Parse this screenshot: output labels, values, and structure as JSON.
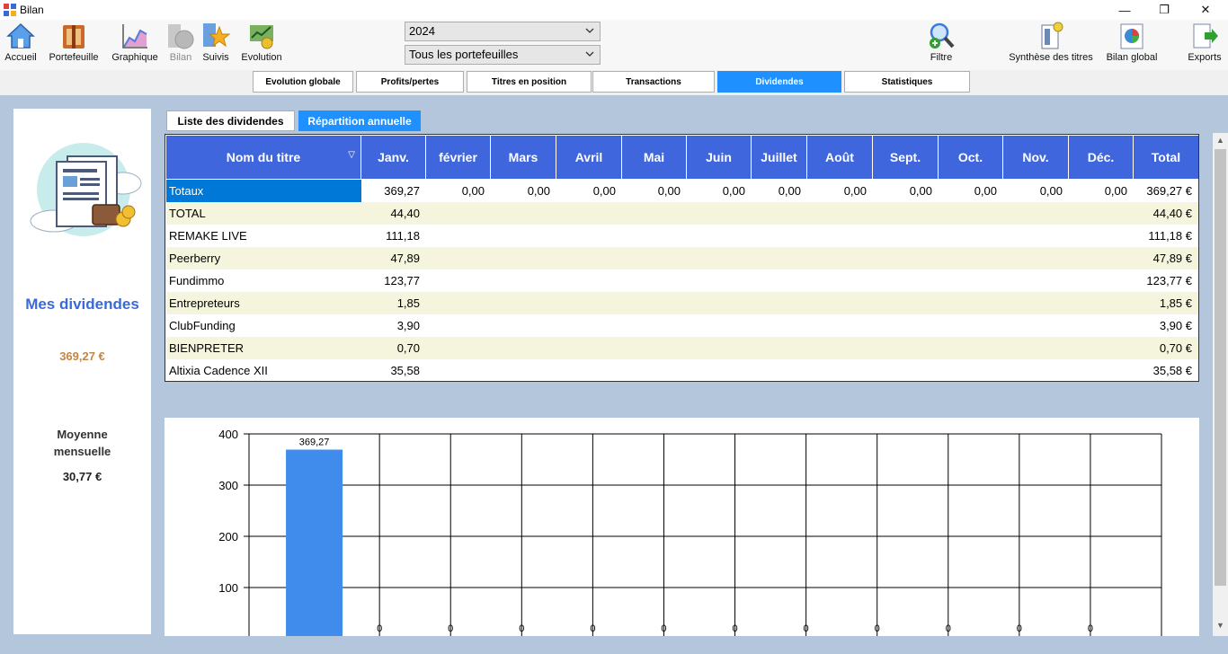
{
  "window": {
    "title": "Bilan",
    "minimize": "—",
    "maximize": "❐",
    "close": "✕"
  },
  "toolbar": {
    "items": [
      {
        "label": "Accueil",
        "icon": "home-icon"
      },
      {
        "label": "Portefeuille",
        "icon": "wallet-book-icon"
      },
      {
        "label": "Graphique",
        "icon": "chart-icon"
      },
      {
        "label": "Bilan",
        "icon": "coins-icon",
        "disabled": true
      },
      {
        "label": "Suivis",
        "icon": "star-bookmark-icon"
      },
      {
        "label": "Evolution",
        "icon": "money-growth-icon"
      },
      {
        "label": "Filtre",
        "icon": "magnifier-plus-icon"
      },
      {
        "label": "Synthèse des titres",
        "icon": "pin-document-icon"
      },
      {
        "label": "Bilan global",
        "icon": "pie-document-icon"
      },
      {
        "label": "Exports",
        "icon": "export-arrow-icon"
      }
    ],
    "year_select": "2024",
    "portfolio_select": "Tous les portefeuilles"
  },
  "main_tabs": [
    {
      "label": "Evolution globale"
    },
    {
      "label": "Profits/pertes"
    },
    {
      "label": "Titres en position"
    },
    {
      "label": "Transactions"
    },
    {
      "label": "Dividendes",
      "active": true
    },
    {
      "label": "Statistiques"
    }
  ],
  "sub_tabs": [
    {
      "label": "Liste des dividendes"
    },
    {
      "label": "Répartition annuelle",
      "active": true
    }
  ],
  "left_panel": {
    "heading": "Mes dividendes",
    "amount": "369,27 €",
    "avg_label_1": "Moyenne",
    "avg_label_2": "mensuelle",
    "avg_value": "30,77 €"
  },
  "table": {
    "columns": [
      "Nom du titre",
      "Janv.",
      "février",
      "Mars",
      "Avril",
      "Mai",
      "Juin",
      "Juillet",
      "Août",
      "Sept.",
      "Oct.",
      "Nov.",
      "Déc.",
      "Total"
    ],
    "sort_glyph": "▽",
    "rows": [
      {
        "name": "Totaux",
        "cells": [
          "369,27",
          "0,00",
          "0,00",
          "0,00",
          "0,00",
          "0,00",
          "0,00",
          "0,00",
          "0,00",
          "0,00",
          "0,00",
          "0,00"
        ],
        "total": "369,27 €"
      },
      {
        "name": "TOTAL",
        "cells": [
          "44,40",
          "",
          "",
          "",
          "",
          "",
          "",
          "",
          "",
          "",
          "",
          ""
        ],
        "total": "44,40 €"
      },
      {
        "name": "REMAKE LIVE",
        "cells": [
          "111,18",
          "",
          "",
          "",
          "",
          "",
          "",
          "",
          "",
          "",
          "",
          ""
        ],
        "total": "111,18 €"
      },
      {
        "name": "Peerberry",
        "cells": [
          "47,89",
          "",
          "",
          "",
          "",
          "",
          "",
          "",
          "",
          "",
          "",
          ""
        ],
        "total": "47,89 €"
      },
      {
        "name": "Fundimmo",
        "cells": [
          "123,77",
          "",
          "",
          "",
          "",
          "",
          "",
          "",
          "",
          "",
          "",
          ""
        ],
        "total": "123,77 €"
      },
      {
        "name": "Entrepreteurs",
        "cells": [
          "1,85",
          "",
          "",
          "",
          "",
          "",
          "",
          "",
          "",
          "",
          "",
          ""
        ],
        "total": "1,85 €"
      },
      {
        "name": "ClubFunding",
        "cells": [
          "3,90",
          "",
          "",
          "",
          "",
          "",
          "",
          "",
          "",
          "",
          "",
          ""
        ],
        "total": "3,90 €"
      },
      {
        "name": "BIENPRETER",
        "cells": [
          "0,70",
          "",
          "",
          "",
          "",
          "",
          "",
          "",
          "",
          "",
          "",
          ""
        ],
        "total": "0,70 €"
      },
      {
        "name": "Altixia Cadence XII",
        "cells": [
          "35,58",
          "",
          "",
          "",
          "",
          "",
          "",
          "",
          "",
          "",
          "",
          ""
        ],
        "total": "35,58 €"
      }
    ]
  },
  "colors": {
    "accent": "#1e90ff",
    "header": "#3f66dd",
    "bar": "#3f8cec",
    "amount": "#c58540",
    "heading": "#3a6ad8"
  },
  "chart_data": {
    "type": "bar",
    "values": [
      369.27,
      0,
      0,
      0,
      0,
      0,
      0,
      0,
      0,
      0,
      0,
      0
    ],
    "data_labels": [
      "369,27",
      "0",
      "0",
      "0",
      "0",
      "0",
      "0",
      "0",
      "0",
      "0",
      "0",
      "0"
    ],
    "y_ticks": [
      "400",
      "300",
      "200",
      "100"
    ],
    "ylim": [
      0,
      400
    ],
    "grid": true,
    "title": "",
    "xlabel": "",
    "ylabel": ""
  }
}
